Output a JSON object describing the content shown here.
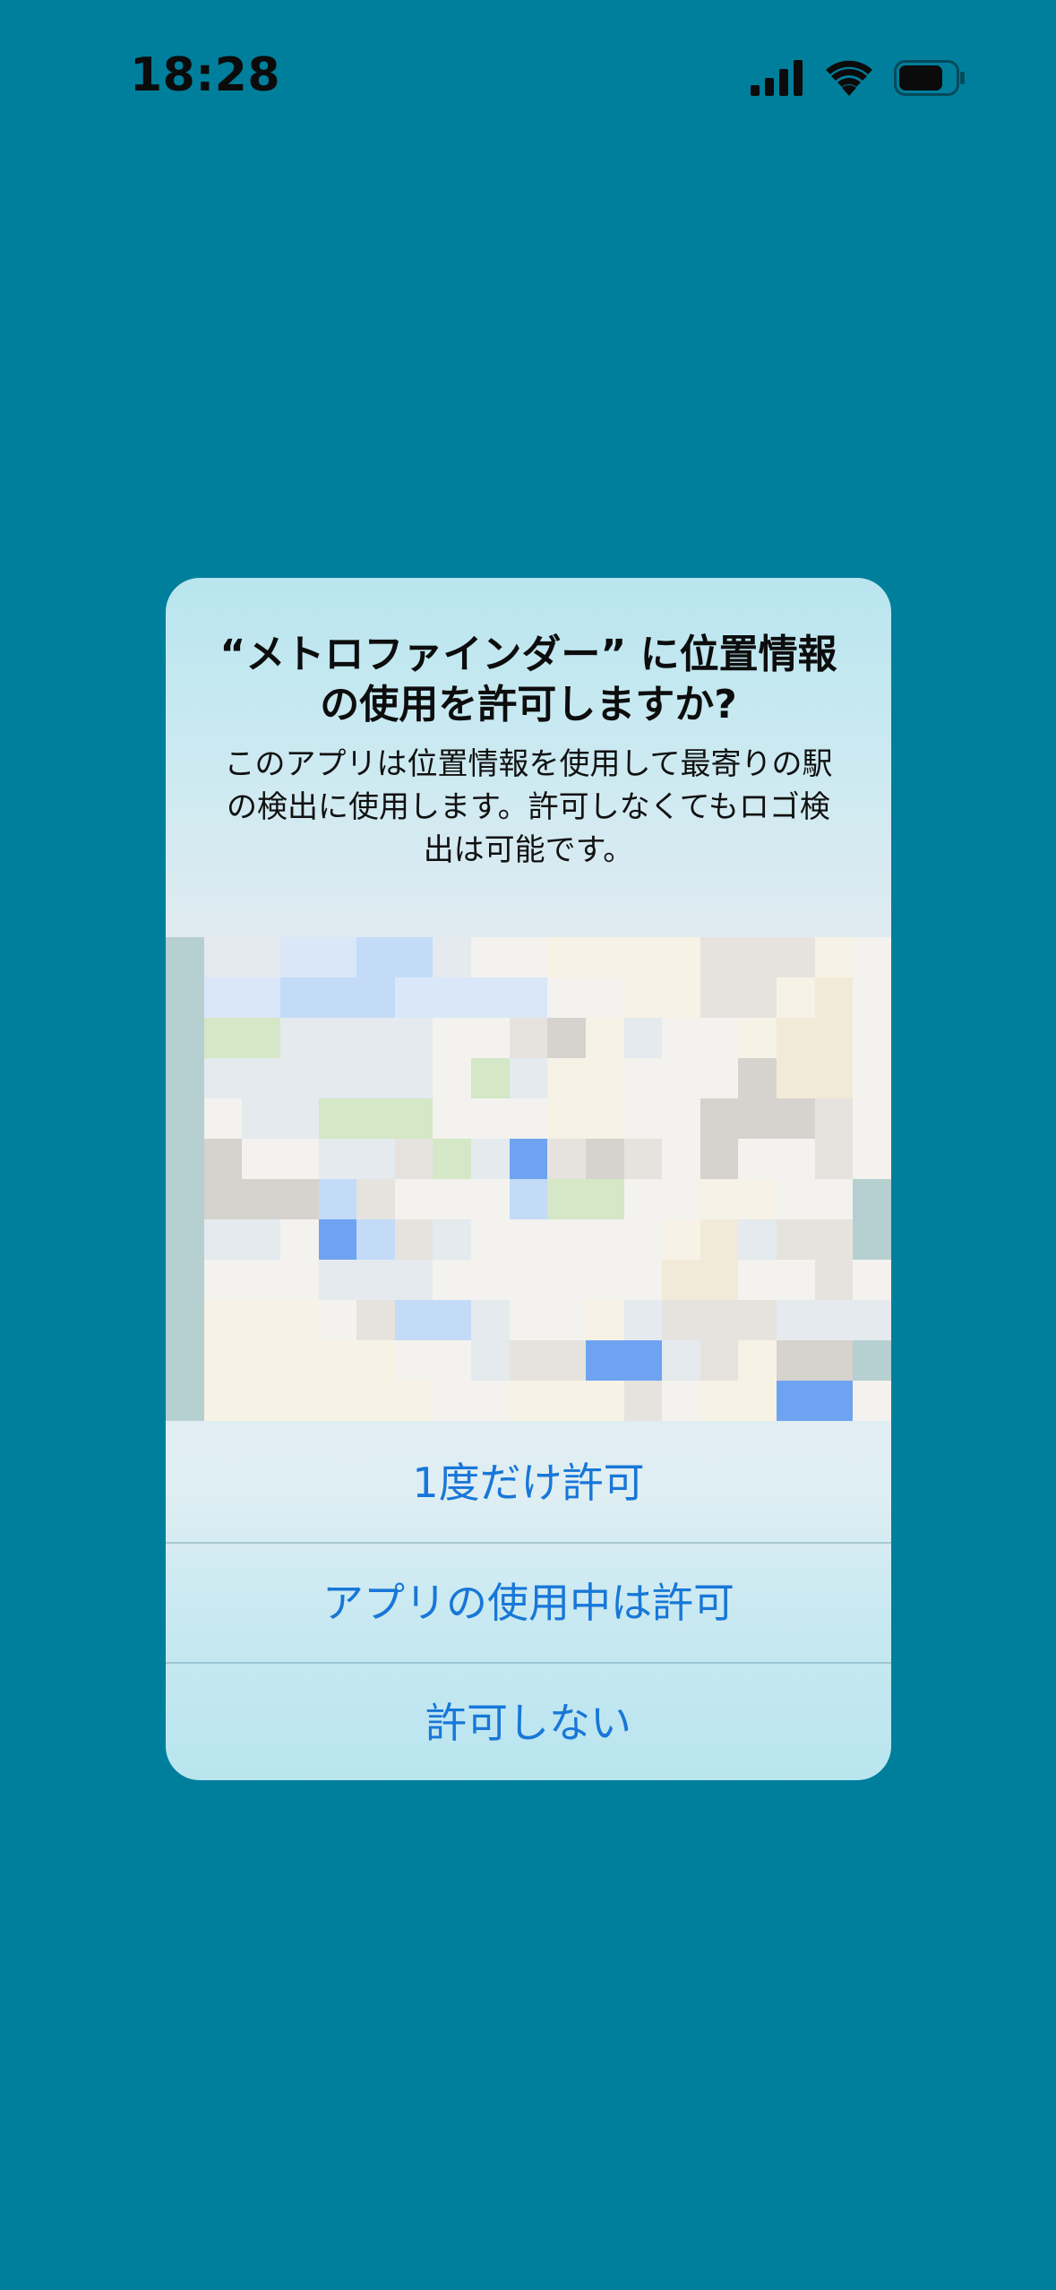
{
  "status_bar": {
    "time": "18:28",
    "icons": [
      "cellular-signal-icon",
      "wifi-icon",
      "battery-icon"
    ]
  },
  "dialog": {
    "title": "“メトロファインダー” に位置情報の使用を許可しますか?",
    "message": "このアプリは位置情報を使用して最寄りの駅の検出に使用します。許可しなくてもロゴ検出は可能です。",
    "map_preview": "blurred-map-image",
    "buttons": {
      "allow_once": "1度だけ許可",
      "allow_while_using": "アプリの使用中は許可",
      "dont_allow": "許可しない"
    }
  },
  "colors": {
    "background": "#007f9c",
    "button_text": "#1877d8",
    "dialog_top": "#b9e5ef"
  }
}
